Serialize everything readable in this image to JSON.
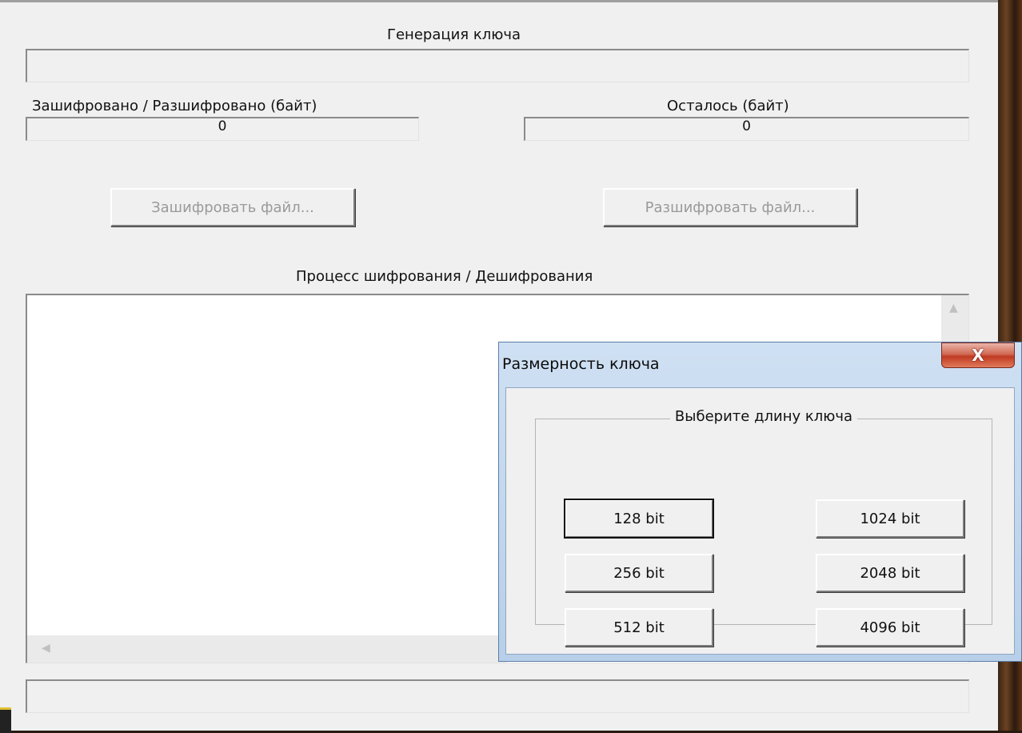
{
  "main": {
    "key_generation_label": "Генерация ключа",
    "encrypted_label": "Зашифровано / Разшифровано (байт)",
    "encrypted_value": "0",
    "remaining_label": "Осталось (байт)",
    "remaining_value": "0",
    "encrypt_button": "Зашифровать файл...",
    "decrypt_button": "Разшифровать файл...",
    "process_label": "Процесс шифрования / Дешифрования"
  },
  "dialog": {
    "title": "Размерность ключа",
    "close_glyph": "X",
    "group_label": "Выберите длину ключа",
    "buttons": {
      "b128": "128 bit",
      "b256": "256 bit",
      "b512": "512 bit",
      "b1024": "1024 bit",
      "b2048": "2048 bit",
      "b4096": "4096 bit"
    }
  },
  "icons": {
    "scroll_up": "scroll-up-arrow-icon",
    "scroll_left": "scroll-left-arrow-icon",
    "close": "close-icon"
  }
}
